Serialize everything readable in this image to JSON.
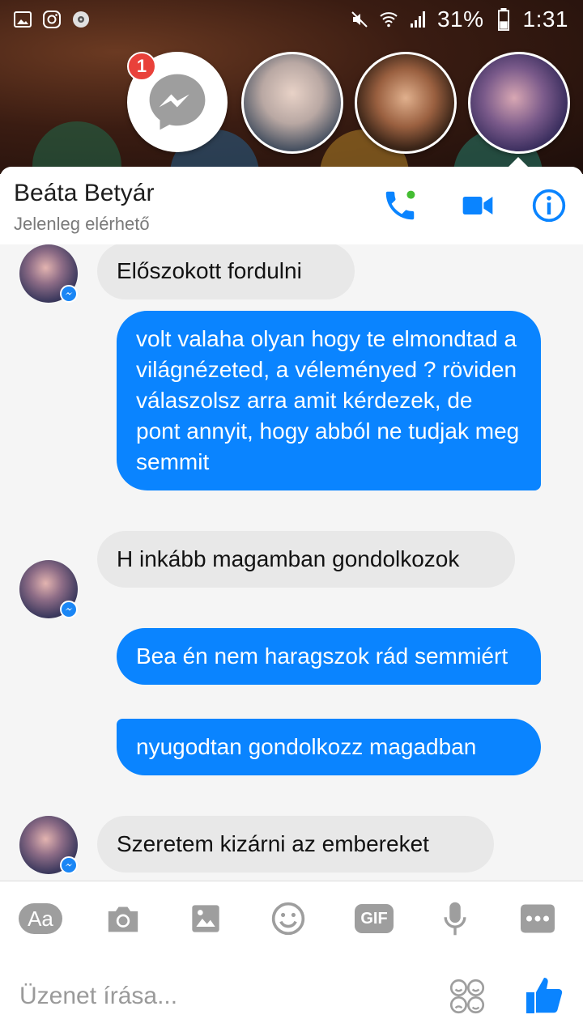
{
  "status_bar": {
    "battery": "31%",
    "time": "1:31",
    "icons_left": [
      "gallery-icon",
      "instagram-icon",
      "media-icon"
    ],
    "icons_right": [
      "mute-icon",
      "wifi-icon",
      "signal-icon",
      "battery-icon"
    ]
  },
  "chat_heads": {
    "unread_badge": "1",
    "heads": [
      "messenger-chat-head",
      "contact-head-1",
      "contact-head-2",
      "contact-head-3"
    ]
  },
  "header": {
    "name": "Beáta Betyár",
    "status": "Jelenleg elérhető",
    "accent_color": "#0a84ff",
    "online_dot_color": "#44bd32"
  },
  "messages": [
    {
      "from": "them",
      "text": "Előszokott fordulni"
    },
    {
      "from": "me",
      "text": "volt valaha olyan hogy te elmondtad a világnézeted, a véleményed ? röviden válaszolsz arra amit kérdezek, de pont annyit, hogy abból ne tudjak meg semmit"
    },
    {
      "from": "them",
      "text": "H inkább magamban gondolkozok"
    },
    {
      "from": "me",
      "text": "Bea én nem haragszok rád semmiért"
    },
    {
      "from": "me",
      "text": "nyugodtan gondolkozz magadban"
    },
    {
      "from": "them",
      "text": "Szeretem kizárni az embereket"
    }
  ],
  "composer": {
    "aa_label": "Aa",
    "gif_label": "GIF",
    "placeholder": "Üzenet írása...",
    "tools": [
      "text-style-button",
      "camera-button",
      "gallery-button",
      "emoji-button",
      "gif-button",
      "microphone-button",
      "more-button"
    ]
  }
}
